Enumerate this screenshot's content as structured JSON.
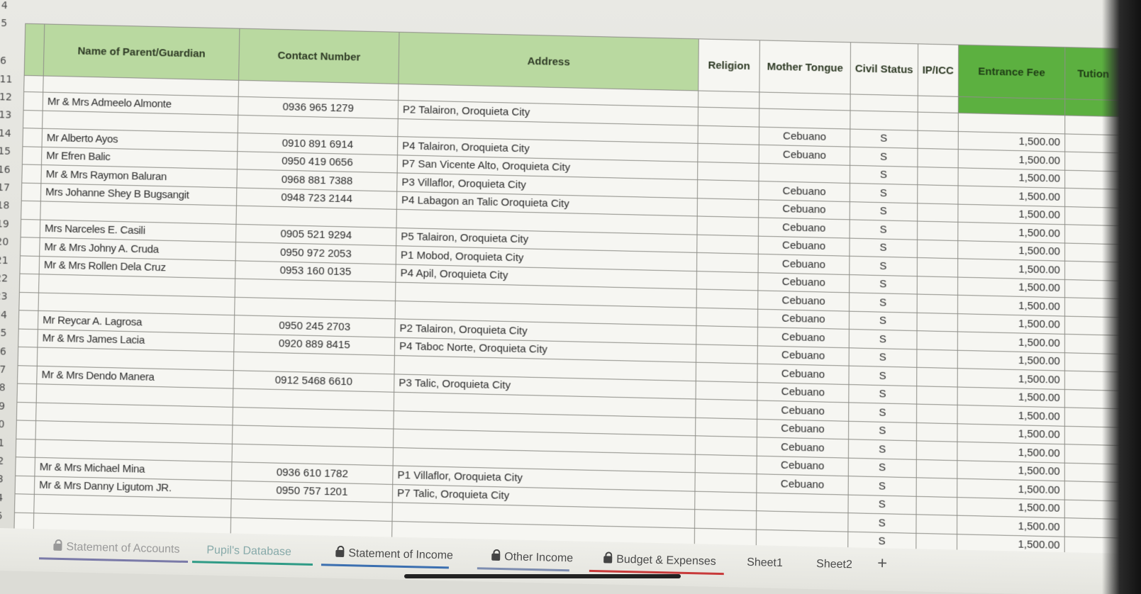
{
  "row_numbers": [
    "4",
    "5",
    "6",
    "11",
    "12",
    "13",
    "14",
    "15",
    "16",
    "17",
    "18",
    "19",
    "20",
    "21",
    "22",
    "23",
    "24",
    "25",
    "26",
    "27",
    "28",
    "29",
    "30",
    "31",
    "32",
    "33",
    "34",
    "35"
  ],
  "headers": {
    "name": "Name of Parent/Guardian",
    "contact": "Contact Number",
    "address": "Address",
    "religion": "Religion",
    "mother_tongue": "Mother Tongue",
    "civil_status": "Civil Status",
    "ip_icc": "IP/ICC",
    "entrance_fee": "Entrance Fee",
    "tuition": "Tution"
  },
  "rows": [
    {
      "num": "12",
      "name": "Mr & Mrs Admeelo Almonte",
      "contact": "0936 965 1279",
      "address": "P2 Talairon, Oroquieta City",
      "mt": "",
      "cs": "",
      "fee": ""
    },
    {
      "num": "13",
      "name": "",
      "contact": "",
      "address": "",
      "mt": "Cebuano",
      "cs": "S",
      "fee": "1,500.00"
    },
    {
      "num": "14",
      "name": "Mr Alberto Ayos",
      "contact": "0910 891 6914",
      "address": "P4 Talairon, Oroquieta City",
      "mt": "Cebuano",
      "cs": "S",
      "fee": "1,500.00"
    },
    {
      "num": "15",
      "name": "Mr Efren Balic",
      "contact": "0950 419 0656",
      "address": "P7 San Vicente Alto, Oroquieta City",
      "mt": "",
      "cs": "S",
      "fee": "1,500.00"
    },
    {
      "num": "16",
      "name": "Mr & Mrs Raymon Baluran",
      "contact": "0968 881 7388",
      "address": "P3 Villaflor, Oroquieta City",
      "mt": "Cebuano",
      "cs": "S",
      "fee": "1,500.00"
    },
    {
      "num": "17",
      "name": "Mrs Johanne Shey B Bugsangit",
      "contact": "0948 723 2144",
      "address": "P4 Labagon an Talic Oroquieta City",
      "mt": "Cebuano",
      "cs": "S",
      "fee": "1,500.00"
    },
    {
      "num": "18",
      "name": "",
      "contact": "",
      "address": "",
      "mt": "Cebuano",
      "cs": "S",
      "fee": "1,500.00"
    },
    {
      "num": "19",
      "name": "Mrs Narceles E. Casili",
      "contact": "0905 521 9294",
      "address": "P5 Talairon, Oroquieta City",
      "mt": "Cebuano",
      "cs": "S",
      "fee": "1,500.00"
    },
    {
      "num": "20",
      "name": "Mr & Mrs Johny A. Cruda",
      "contact": "0950 972 2053",
      "address": "P1 Mobod, Oroquieta City",
      "mt": "Cebuano",
      "cs": "S",
      "fee": "1,500.00"
    },
    {
      "num": "21",
      "name": "Mr & Mrs Rollen Dela Cruz",
      "contact": "0953 160 0135",
      "address": "P4 Apil, Oroquieta City",
      "mt": "Cebuano",
      "cs": "S",
      "fee": "1,500.00"
    },
    {
      "num": "22",
      "name": "",
      "contact": "",
      "address": "",
      "mt": "Cebuano",
      "cs": "S",
      "fee": "1,500.00"
    },
    {
      "num": "23",
      "name": "",
      "contact": "",
      "address": "",
      "mt": "Cebuano",
      "cs": "S",
      "fee": "1,500.00"
    },
    {
      "num": "24",
      "name": "Mr Reycar A. Lagrosa",
      "contact": "0950 245 2703",
      "address": "P2 Talairon, Oroquieta City",
      "mt": "Cebuano",
      "cs": "S",
      "fee": "1,500.00"
    },
    {
      "num": "25",
      "name": "Mr & Mrs James Lacia",
      "contact": "0920 889 8415",
      "address": "P4 Taboc Norte, Oroquieta City",
      "mt": "Cebuano",
      "cs": "S",
      "fee": "1,500.00"
    },
    {
      "num": "26",
      "name": "",
      "contact": "",
      "address": "",
      "mt": "Cebuano",
      "cs": "S",
      "fee": "1,500.00"
    },
    {
      "num": "27",
      "name": "Mr & Mrs Dendo Manera",
      "contact": "0912 5468 6610",
      "address": "P3 Talic, Oroquieta City",
      "mt": "Cebuano",
      "cs": "S",
      "fee": "1,500.00"
    },
    {
      "num": "28",
      "name": "",
      "contact": "",
      "address": "",
      "mt": "Cebuano",
      "cs": "S",
      "fee": "1,500.00"
    },
    {
      "num": "29",
      "name": "",
      "contact": "",
      "address": "",
      "mt": "Cebuano",
      "cs": "S",
      "fee": "1,500.00"
    },
    {
      "num": "30",
      "name": "",
      "contact": "",
      "address": "",
      "mt": "Cebuano",
      "cs": "S",
      "fee": "1,500.00"
    },
    {
      "num": "31",
      "name": "",
      "contact": "",
      "address": "",
      "mt": "Cebuano",
      "cs": "S",
      "fee": "1,500.00"
    },
    {
      "num": "32",
      "name": "Mr & Mrs Michael Mina",
      "contact": "0936 610 1782",
      "address": "P1 Villaflor, Oroquieta City",
      "mt": "Cebuano",
      "cs": "S",
      "fee": "1,500.00"
    },
    {
      "num": "33",
      "name": "Mr & Mrs Danny Ligutom JR.",
      "contact": "0950 757 1201",
      "address": "P7 Talic, Oroquieta City",
      "mt": "",
      "cs": "S",
      "fee": "1,500.00"
    },
    {
      "num": "34",
      "name": "",
      "contact": "",
      "address": "",
      "mt": "",
      "cs": "S",
      "fee": "1,500.00"
    },
    {
      "num": "35",
      "name": "",
      "contact": "",
      "address": "",
      "mt": "",
      "cs": "S",
      "fee": "1,500.00"
    }
  ],
  "tabs": [
    {
      "label": "Statement of Accounts",
      "locked": true,
      "state": "faded",
      "underline": "#7a7aa8"
    },
    {
      "label": "Pupil's Database",
      "locked": false,
      "state": "active",
      "underline": "#2f9b86"
    },
    {
      "label": "Statement of Income",
      "locked": true,
      "state": "normal",
      "underline": "#3b6fb0"
    },
    {
      "label": "Other Income",
      "locked": true,
      "state": "normal",
      "underline": "#7d8db0"
    },
    {
      "label": "Budget & Expenses",
      "locked": true,
      "state": "normal",
      "underline": "#c83a3a"
    },
    {
      "label": "Sheet1",
      "locked": false,
      "state": "normal",
      "underline": ""
    },
    {
      "label": "Sheet2",
      "locked": false,
      "state": "normal",
      "underline": ""
    }
  ],
  "add_sheet": "+",
  "colors": {
    "header_green": "#b9d9a0",
    "header_green_strong": "#5cb040"
  }
}
